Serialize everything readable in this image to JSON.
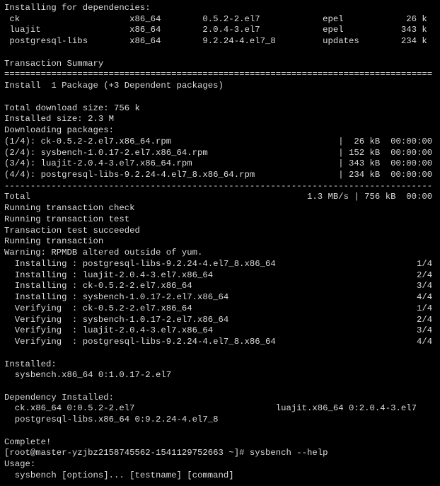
{
  "deps_header": "Installing for dependencies:",
  "deps": [
    {
      "name": "ck",
      "arch": "x86_64",
      "ver": "0.5.2-2.el7",
      "repo": "epel",
      "size": "26 k"
    },
    {
      "name": "luajit",
      "arch": "x86_64",
      "ver": "2.0.4-3.el7",
      "repo": "epel",
      "size": "343 k"
    },
    {
      "name": "postgresql-libs",
      "arch": "x86_64",
      "ver": "9.2.24-4.el7_8",
      "repo": "updates",
      "size": "234 k"
    }
  ],
  "txn_summary_title": "Transaction Summary",
  "install_line": "Install  1 Package (+3 Dependent packages)",
  "total_download_size": "Total download size: 756 k",
  "installed_size": "Installed size: 2.3 M",
  "downloading_header": "Downloading packages:",
  "downloads": [
    {
      "idx": "(1/4)",
      "name": "ck-0.5.2-2.el7.x86_64.rpm",
      "size": "26 kB",
      "time": "00:00:00"
    },
    {
      "idx": "(2/4)",
      "name": "sysbench-1.0.17-2.el7.x86_64.rpm",
      "size": "152 kB",
      "time": "00:00:00"
    },
    {
      "idx": "(3/4)",
      "name": "luajit-2.0.4-3.el7.x86_64.rpm",
      "size": "343 kB",
      "time": "00:00:00"
    },
    {
      "idx": "(4/4)",
      "name": "postgresql-libs-9.2.24-4.el7_8.x86_64.rpm",
      "size": "234 kB",
      "time": "00:00:00"
    }
  ],
  "total_line": {
    "label": "Total",
    "rate": "1.3 MB/s",
    "size": "756 kB",
    "time": "00:00"
  },
  "post_lines": [
    "Running transaction check",
    "Running transaction test",
    "Transaction test succeeded",
    "Running transaction",
    "Warning: RPMDB altered outside of yum."
  ],
  "install_steps": [
    {
      "act": "Installing",
      "pkg": "postgresql-libs-9.2.24-4.el7_8.x86_64",
      "frac": "1/4"
    },
    {
      "act": "Installing",
      "pkg": "luajit-2.0.4-3.el7.x86_64",
      "frac": "2/4"
    },
    {
      "act": "Installing",
      "pkg": "ck-0.5.2-2.el7.x86_64",
      "frac": "3/4"
    },
    {
      "act": "Installing",
      "pkg": "sysbench-1.0.17-2.el7.x86_64",
      "frac": "4/4"
    },
    {
      "act": "Verifying ",
      "pkg": "ck-0.5.2-2.el7.x86_64",
      "frac": "1/4"
    },
    {
      "act": "Verifying ",
      "pkg": "sysbench-1.0.17-2.el7.x86_64",
      "frac": "2/4"
    },
    {
      "act": "Verifying ",
      "pkg": "luajit-2.0.4-3.el7.x86_64",
      "frac": "3/4"
    },
    {
      "act": "Verifying ",
      "pkg": "postgresql-libs-9.2.24-4.el7_8.x86_64",
      "frac": "4/4"
    }
  ],
  "installed_header": "Installed:",
  "installed_pkg": "sysbench.x86_64 0:1.0.17-2.el7",
  "dep_installed_header": "Dependency Installed:",
  "dep_installed": [
    "ck.x86_64 0:0.5.2-2.el7",
    "luajit.x86_64 0:2.0.4-3.el7",
    "postgresql-libs.x86_64 0:9.2.24-4.el7_8"
  ],
  "complete": "Complete!",
  "prompt": "[root@master-yzjbz2158745562-1541129752663 ~]# ",
  "cmd": "sysbench --help",
  "usage_header": "Usage:",
  "usage_line": "sysbench [options]... [testname] [command]"
}
